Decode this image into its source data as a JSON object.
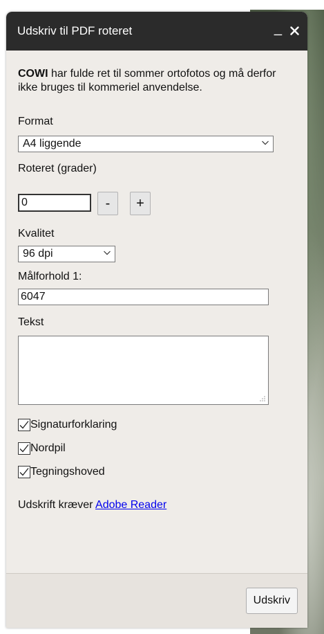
{
  "dialog": {
    "title": "Udskriv til PDF roteret",
    "minimize_glyph": "_",
    "close_glyph": "✕"
  },
  "notice": {
    "brand": "COWI",
    "text": " har fulde ret til sommer ortofotos og må derfor ikke bruges til kommeriel anvendelse."
  },
  "format": {
    "label": "Format",
    "selected": "A4 liggende"
  },
  "rotation": {
    "label": "Roteret (grader)",
    "value": "0",
    "minus_label": "-",
    "plus_label": "+"
  },
  "quality": {
    "label": "Kvalitet",
    "selected": "96 dpi"
  },
  "scale": {
    "label": "Målforhold 1:",
    "value": "6047"
  },
  "text_field": {
    "label": "Tekst",
    "value": ""
  },
  "checkboxes": [
    {
      "label": "Signaturforklaring",
      "checked": true
    },
    {
      "label": "Nordpil",
      "checked": true
    },
    {
      "label": "Tegningshoved",
      "checked": true
    }
  ],
  "reader_note": {
    "prefix": "Udskrift kræver ",
    "link": "Adobe Reader"
  },
  "footer": {
    "print_label": "Udskriv"
  },
  "colors": {
    "titlebar": "#2b2b2b",
    "panel": "#efece8",
    "link": "#0000ee"
  }
}
